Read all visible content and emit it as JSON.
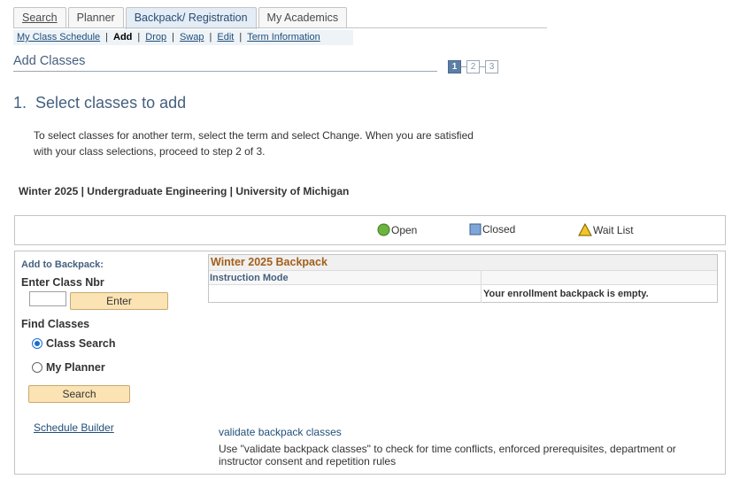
{
  "tabs": [
    {
      "label": "Search",
      "active": false
    },
    {
      "label": "Planner",
      "active": false
    },
    {
      "label": "Backpack/ Registration",
      "active": true
    },
    {
      "label": "My Academics",
      "active": false
    }
  ],
  "subnav": {
    "my_class_schedule": "My Class Schedule",
    "add": "Add",
    "drop": "Drop",
    "swap": "Swap",
    "edit": "Edit",
    "term_information": "Term Information",
    "separator": "|"
  },
  "page_header": "Add Classes",
  "steps": [
    "1",
    "2",
    "3"
  ],
  "current_step": 1,
  "step_title": "1.  Select classes to add",
  "instructions": "To select classes for another term, select the term and select Change.  When you are satisfied with your class selections, proceed to step 2 of 3.",
  "term_line": "Winter 2025 | Undergraduate Engineering | University of Michigan",
  "legend": [
    {
      "label": "Open",
      "icon": "green-circle-icon",
      "color": "#6db33f"
    },
    {
      "label": "Closed",
      "icon": "blue-square-icon",
      "color": "#7fa6d9"
    },
    {
      "label": "Wait List",
      "icon": "yellow-triangle-icon",
      "color": "#f3c623"
    }
  ],
  "add_panel": {
    "add_to_backpack_label": "Add to Backpack:",
    "enter_class_nbr_label": "Enter Class Nbr",
    "class_nbr_value": "",
    "enter_button": "Enter",
    "find_classes_label": "Find Classes",
    "options": [
      {
        "label": "Class Search",
        "selected": true
      },
      {
        "label": "My Planner",
        "selected": false
      }
    ],
    "search_button": "Search",
    "schedule_builder_link": "Schedule Builder"
  },
  "backpack": {
    "title": "Winter 2025 Backpack",
    "column_header": "Instruction Mode",
    "empty_message": "Your enrollment backpack is empty."
  },
  "validate": {
    "link": "validate backpack classes",
    "description": "Use \"validate backpack classes\" to check for time conflicts, enforced prerequisites, department or instructor consent and repetition rules"
  }
}
